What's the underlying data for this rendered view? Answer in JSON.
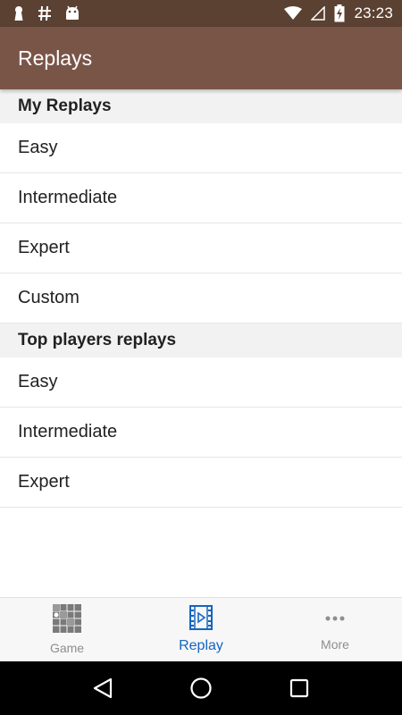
{
  "status_bar": {
    "time": "23:23",
    "left_icons": [
      "keyhole-icon",
      "hash-icon",
      "android-icon"
    ],
    "right_icons": [
      "wifi-icon",
      "cell-signal-icon",
      "battery-charging-icon"
    ]
  },
  "app_bar": {
    "title": "Replays",
    "color": "#795548",
    "status_color": "#5b4132"
  },
  "sections": [
    {
      "header": "My Replays",
      "items": [
        "Easy",
        "Intermediate",
        "Expert",
        "Custom"
      ]
    },
    {
      "header": "Top players replays",
      "items": [
        "Easy",
        "Intermediate",
        "Expert"
      ]
    }
  ],
  "bottom_nav": {
    "items": [
      {
        "label": "Game",
        "icon": "minesweeper-grid-icon",
        "active": false
      },
      {
        "label": "Replay",
        "icon": "film-play-icon",
        "active": true
      },
      {
        "label": "More",
        "icon": "more-dots-icon",
        "active": false
      }
    ],
    "active_color": "#1565c0"
  },
  "system_nav": {
    "buttons": [
      "back-icon",
      "home-icon",
      "recents-icon"
    ]
  }
}
